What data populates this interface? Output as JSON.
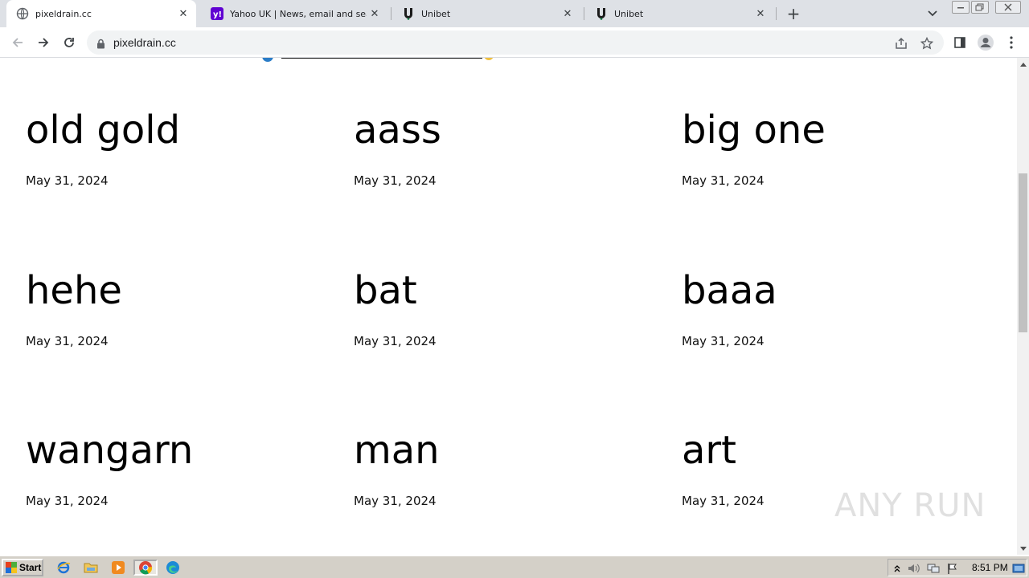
{
  "browser": {
    "tabs": [
      {
        "title": "pixeldrain.cc",
        "icon": "globe-icon",
        "active": true
      },
      {
        "title": "Yahoo UK | News, email and search",
        "icon": "yahoo-icon",
        "active": false
      },
      {
        "title": "Unibet",
        "icon": "unibet-icon",
        "active": false
      },
      {
        "title": "Unibet",
        "icon": "unibet-icon",
        "active": false
      }
    ],
    "new_tab_label": "+",
    "close_glyph": "✕",
    "url": "pixeldrain.cc"
  },
  "page": {
    "cards": [
      {
        "name": "old gold",
        "date": "May 31, 2024"
      },
      {
        "name": "aass",
        "date": "May 31, 2024"
      },
      {
        "name": "big one",
        "date": "May 31, 2024"
      },
      {
        "name": "hehe",
        "date": "May 31, 2024"
      },
      {
        "name": "bat",
        "date": "May 31, 2024"
      },
      {
        "name": "baaa",
        "date": "May 31, 2024"
      },
      {
        "name": "wangarn",
        "date": "May 31, 2024"
      },
      {
        "name": "man",
        "date": "May 31, 2024"
      },
      {
        "name": "art",
        "date": "May 31, 2024"
      }
    ],
    "watermark": "ANY RUN"
  },
  "taskbar": {
    "start_label": "Start",
    "clock": "8:51 PM"
  },
  "colors": {
    "tabstrip_bg": "#dee1e6",
    "yahoo_purple": "#6001d2",
    "unibet_green": "#147b45"
  }
}
